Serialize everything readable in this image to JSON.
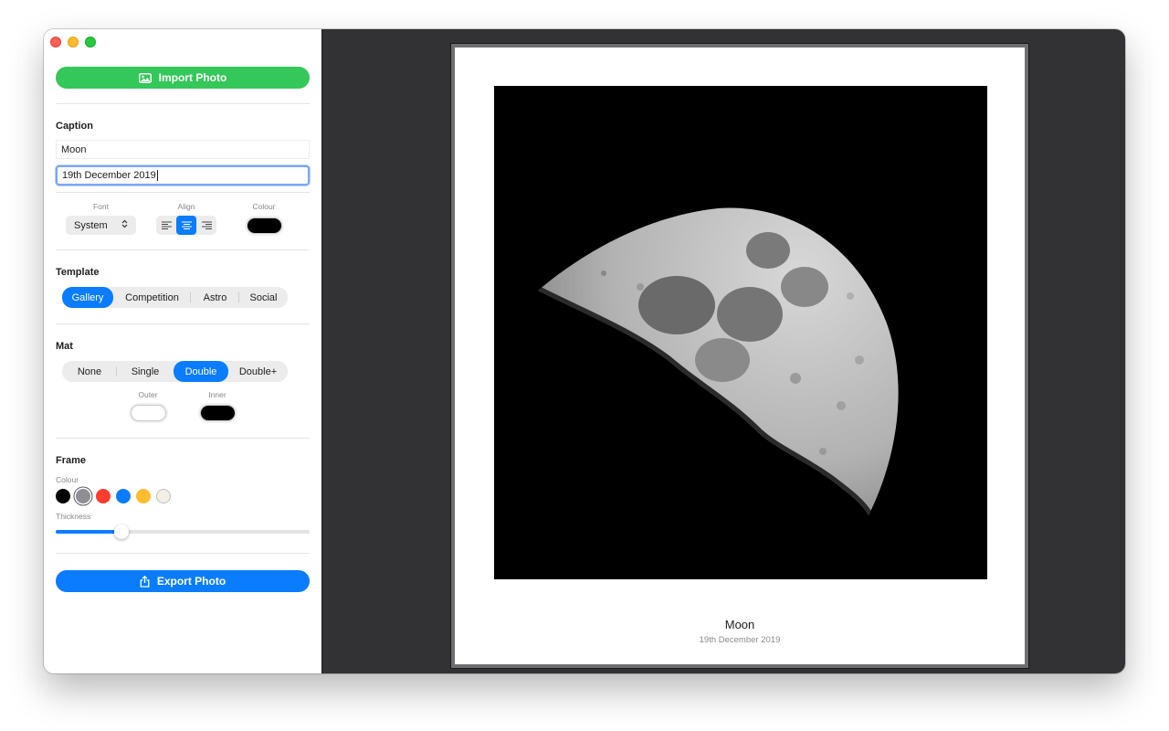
{
  "sidebar": {
    "import_label": "Import Photo",
    "export_label": "Export Photo",
    "caption": {
      "heading": "Caption",
      "title_value": "Moon",
      "subtitle_value": "19th December 2019",
      "font_label": "Font",
      "font_value": "System",
      "align_label": "Align",
      "align_selected": "center",
      "colour_label": "Colour",
      "colour_value": "#000000"
    },
    "template": {
      "heading": "Template",
      "options": [
        "Gallery",
        "Competition",
        "Astro",
        "Social"
      ],
      "selected": "Gallery"
    },
    "mat": {
      "heading": "Mat",
      "options": [
        "None",
        "Single",
        "Double",
        "Double+"
      ],
      "selected": "Double",
      "outer_label": "Outer",
      "outer_colour": "#ffffff",
      "inner_label": "Inner",
      "inner_colour": "#000000"
    },
    "frame": {
      "heading": "Frame",
      "colour_label": "Colour",
      "colours": [
        "#000000",
        "#8e8e93",
        "#ff3b30",
        "#0a7cff",
        "#febc2e",
        "#f2f0e6"
      ],
      "selected_colour": "#8e8e93",
      "thickness_label": "Thickness",
      "thickness_fraction": 0.26
    }
  },
  "preview": {
    "title": "Moon",
    "subtitle": "19th December 2019",
    "photo_subject": "moon-photo"
  }
}
